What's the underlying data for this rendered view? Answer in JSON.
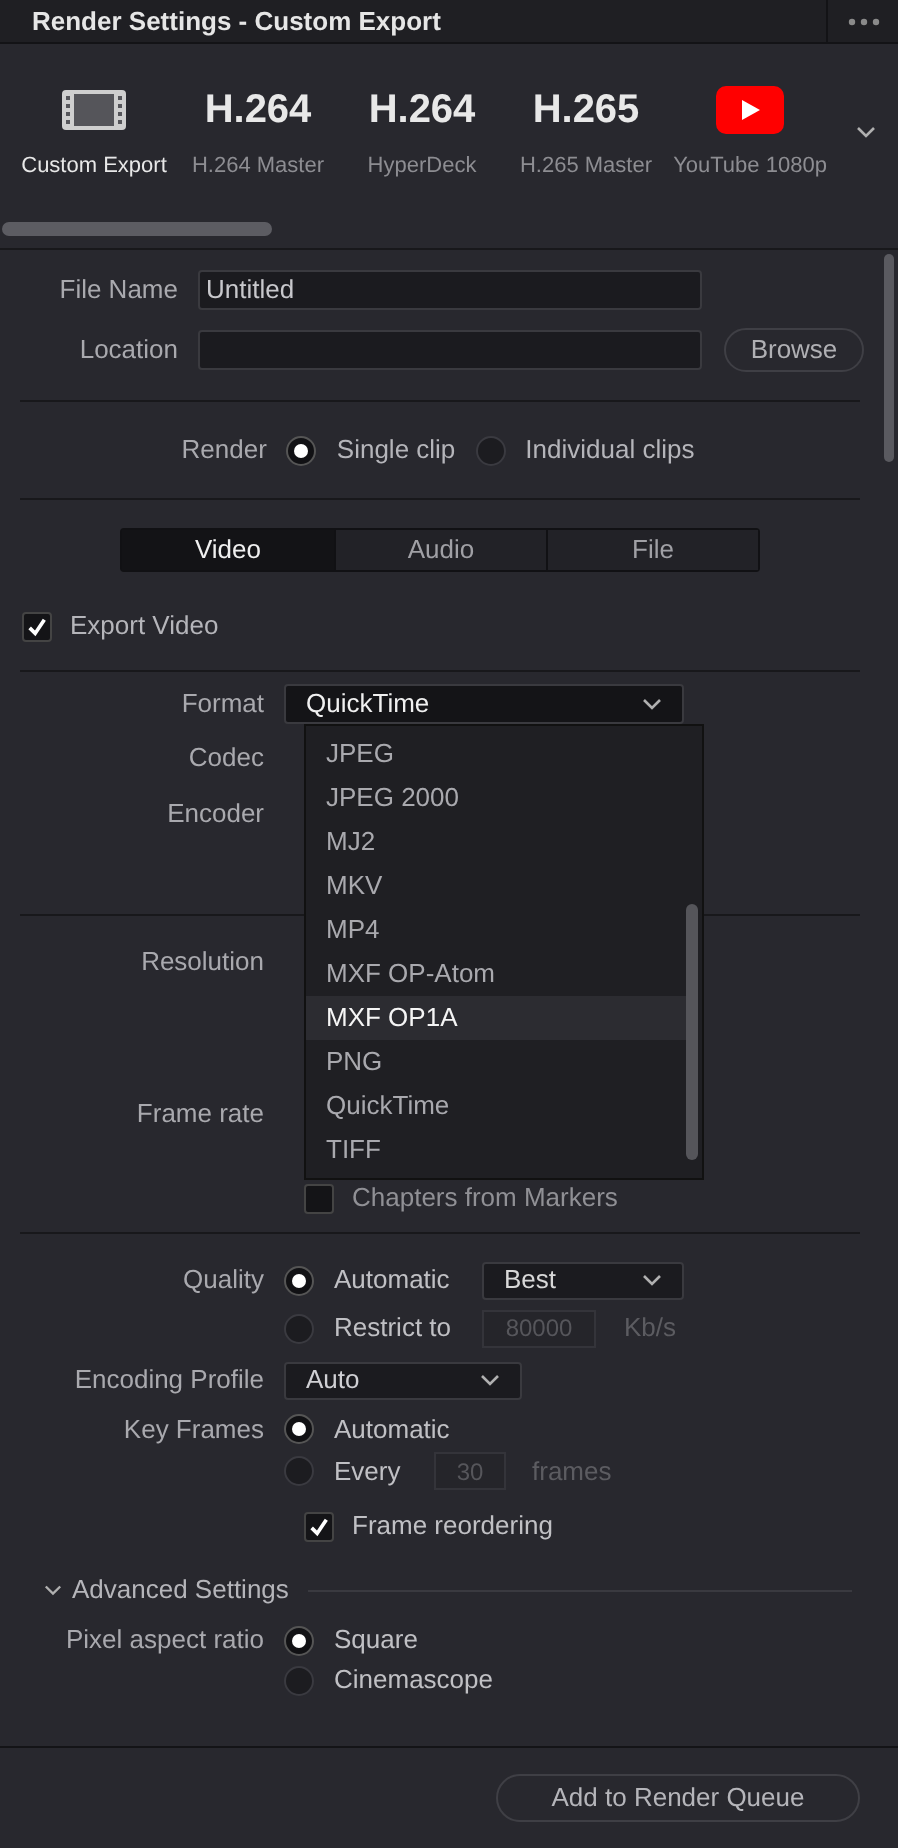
{
  "window": {
    "title": "Render Settings - Custom Export"
  },
  "presets": [
    {
      "kind": "film",
      "label": "Custom Export",
      "selected": true
    },
    {
      "kind": "text",
      "glyph": "H.264",
      "label": "H.264 Master",
      "selected": false
    },
    {
      "kind": "text",
      "glyph": "H.264",
      "label": "HyperDeck",
      "selected": false
    },
    {
      "kind": "text",
      "glyph": "H.265",
      "label": "H.265 Master",
      "selected": false
    },
    {
      "kind": "youtube",
      "label": "YouTube 1080p",
      "selected": false
    }
  ],
  "file_name": {
    "label": "File Name",
    "value": "Untitled"
  },
  "location": {
    "label": "Location"
  },
  "browse_button": "Browse",
  "render": {
    "label": "Render",
    "options": [
      {
        "label": "Single clip",
        "selected": true
      },
      {
        "label": "Individual clips",
        "selected": false
      }
    ]
  },
  "tabs": [
    {
      "label": "Video",
      "selected": true
    },
    {
      "label": "Audio",
      "selected": false
    },
    {
      "label": "File",
      "selected": false
    }
  ],
  "export_video": {
    "label": "Export Video",
    "checked": true
  },
  "format": {
    "label": "Format",
    "value": "QuickTime",
    "expanded": true,
    "options": [
      {
        "label": "JPEG",
        "highlighted": false
      },
      {
        "label": "JPEG 2000",
        "highlighted": false
      },
      {
        "label": "MJ2",
        "highlighted": false
      },
      {
        "label": "MKV",
        "highlighted": false
      },
      {
        "label": "MP4",
        "highlighted": false
      },
      {
        "label": "MXF OP-Atom",
        "highlighted": false
      },
      {
        "label": "MXF OP1A",
        "highlighted": true
      },
      {
        "label": "PNG",
        "highlighted": false
      },
      {
        "label": "QuickTime",
        "highlighted": false
      },
      {
        "label": "TIFF",
        "highlighted": false
      }
    ]
  },
  "codec": {
    "label": "Codec"
  },
  "encoder": {
    "label": "Encoder"
  },
  "resolution": {
    "label": "Resolution"
  },
  "frame_rate": {
    "label": "Frame rate"
  },
  "chapters": {
    "label": "Chapters from Markers",
    "checked": false
  },
  "quality": {
    "label": "Quality",
    "options": [
      {
        "label": "Automatic",
        "selected": true,
        "value": "Best"
      },
      {
        "label": "Restrict to",
        "selected": false,
        "value": "80000",
        "unit": "Kb/s"
      }
    ]
  },
  "encoding_profile": {
    "label": "Encoding Profile",
    "value": "Auto"
  },
  "key_frames": {
    "label": "Key Frames",
    "options": [
      {
        "label": "Automatic",
        "selected": true
      },
      {
        "label": "Every",
        "selected": false,
        "value": "30",
        "unit": "frames"
      }
    ]
  },
  "frame_reordering": {
    "label": "Frame reordering",
    "checked": true
  },
  "advanced": {
    "label": "Advanced Settings",
    "expanded": true
  },
  "pixel_aspect": {
    "label": "Pixel aspect ratio",
    "options": [
      {
        "label": "Square",
        "selected": true
      },
      {
        "label": "Cinemascope",
        "selected": false
      }
    ]
  },
  "add_button": "Add to Render Queue"
}
